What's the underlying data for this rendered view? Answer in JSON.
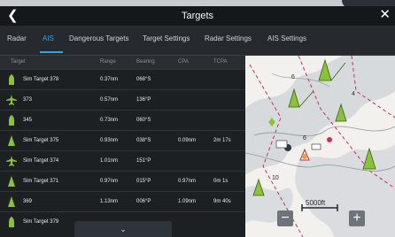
{
  "titlebar": {
    "title": "Targets",
    "back_icon": "chevron-left-icon",
    "close_icon": "close-icon"
  },
  "tabs": [
    {
      "label": "Radar",
      "active": false
    },
    {
      "label": "AIS",
      "active": true
    },
    {
      "label": "Dangerous Targets",
      "active": false
    },
    {
      "label": "Target Settings",
      "active": false
    },
    {
      "label": "Radar Settings",
      "active": false
    },
    {
      "label": "AIS Settings",
      "active": false
    }
  ],
  "table": {
    "headers": {
      "target": "Target",
      "range": "Range",
      "bearing": "Bearing",
      "cpa": "CPA",
      "tcpa": "TCPA"
    },
    "rows": [
      {
        "icon": "vessel-icon",
        "target": "Sim Target 378",
        "range": "0.37nm",
        "bearing": "068°S",
        "cpa": "",
        "tcpa": ""
      },
      {
        "icon": "aircraft-icon",
        "target": "373",
        "range": "0.57nm",
        "bearing": "136°P",
        "cpa": "",
        "tcpa": ""
      },
      {
        "icon": "vessel-icon",
        "target": "345",
        "range": "0.73nm",
        "bearing": "060°S",
        "cpa": "",
        "tcpa": ""
      },
      {
        "icon": "triangle-target-icon",
        "target": "Sim Target 375",
        "range": "0.93nm",
        "bearing": "038°S",
        "cpa": "0.09nm",
        "tcpa": "2m 17s"
      },
      {
        "icon": "aircraft-icon",
        "target": "Sim Target 374",
        "range": "1.01nm",
        "bearing": "151°P",
        "cpa": "",
        "tcpa": ""
      },
      {
        "icon": "triangle-target-icon",
        "target": "Sim Target 371",
        "range": "0.97nm",
        "bearing": "015°P",
        "cpa": "0.97nm",
        "tcpa": "0m 1s"
      },
      {
        "icon": "triangle-target-icon",
        "target": "369",
        "range": "1.13nm",
        "bearing": "006°P",
        "cpa": "1.09nm",
        "tcpa": "9m 40s"
      },
      {
        "icon": "vessel-icon",
        "target": "Sim Target 379",
        "range": "",
        "bearing": "",
        "cpa": "",
        "tcpa": ""
      }
    ],
    "pull_icon": "chevron-down-icon"
  },
  "map": {
    "scale_label": "5000ft",
    "zoom_out_label": "−",
    "zoom_in_label": "+",
    "colors": {
      "land": "#f3f1ee",
      "shallow": "#c7cdd3",
      "danger": "#c8305a",
      "target": "#8ac33b"
    }
  }
}
